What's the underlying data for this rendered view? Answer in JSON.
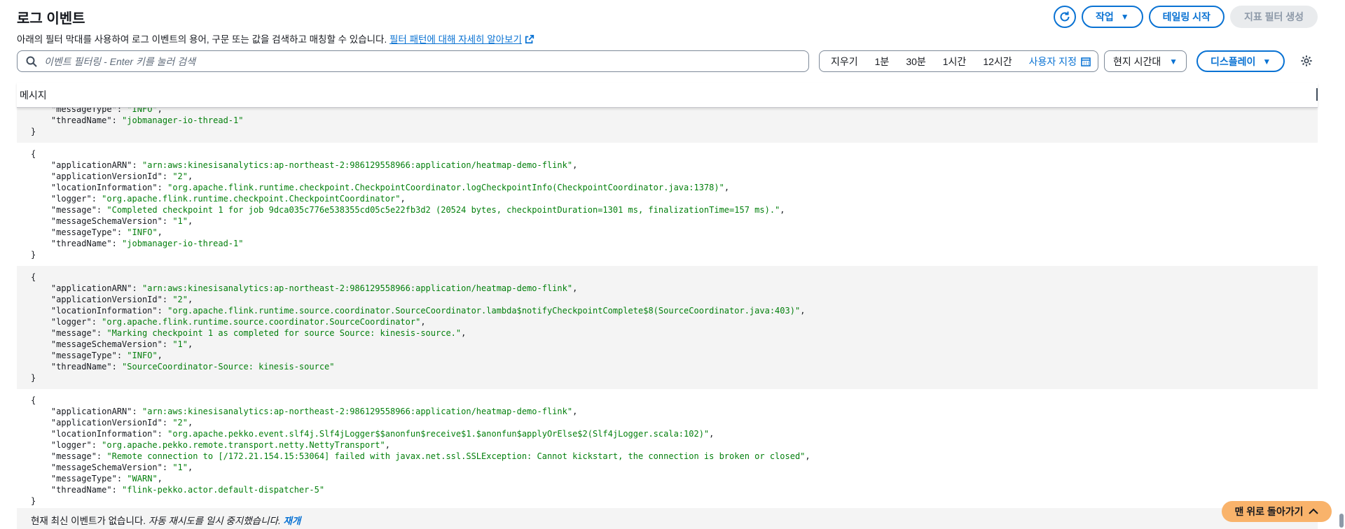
{
  "header": {
    "title": "로그 이벤트",
    "description": "아래의 필터 막대를 사용하여 로그 이벤트의 용어, 구문 또는 값을 검색하고 매칭할 수 있습니다.",
    "learn_more": "필터 패턴에 대해 자세히 알아보기"
  },
  "actions": {
    "refresh_icon": "refresh-icon",
    "actions_label": "작업",
    "tail_label": "테일링 시작",
    "metric_filter_label": "지표 필터 생성"
  },
  "search": {
    "placeholder": "이벤트 필터링 - Enter 키를 눌러 검색"
  },
  "time_range": {
    "options": [
      "지우기",
      "1분",
      "30분",
      "1시간",
      "12시간",
      "사용자 지정"
    ]
  },
  "timezone": {
    "value": "현지 시간대"
  },
  "display": {
    "label": "디스플레이"
  },
  "table": {
    "column": "메시지"
  },
  "entries": [
    {
      "shaded": true,
      "partial": true,
      "lines": [
        {
          "k": "messageType",
          "v": "INFO",
          "comma": true
        },
        {
          "k": "threadName",
          "v": "jobmanager-io-thread-1",
          "comma": false
        }
      ]
    },
    {
      "shaded": false,
      "partial": false,
      "lines": [
        {
          "k": "applicationARN",
          "v": "arn:aws:kinesisanalytics:ap-northeast-2:986129558966:application/heatmap-demo-flink",
          "comma": true
        },
        {
          "k": "applicationVersionId",
          "v": "2",
          "comma": true
        },
        {
          "k": "locationInformation",
          "v": "org.apache.flink.runtime.checkpoint.CheckpointCoordinator.logCheckpointInfo(CheckpointCoordinator.java:1378)",
          "comma": true
        },
        {
          "k": "logger",
          "v": "org.apache.flink.runtime.checkpoint.CheckpointCoordinator",
          "comma": true
        },
        {
          "k": "message",
          "v": "Completed checkpoint 1 for job 9dca035c776e538355cd05c5e22fb3d2 (20524 bytes, checkpointDuration=1301 ms, finalizationTime=157 ms).",
          "comma": true
        },
        {
          "k": "messageSchemaVersion",
          "v": "1",
          "comma": true
        },
        {
          "k": "messageType",
          "v": "INFO",
          "comma": true
        },
        {
          "k": "threadName",
          "v": "jobmanager-io-thread-1",
          "comma": false
        }
      ]
    },
    {
      "shaded": true,
      "partial": false,
      "lines": [
        {
          "k": "applicationARN",
          "v": "arn:aws:kinesisanalytics:ap-northeast-2:986129558966:application/heatmap-demo-flink",
          "comma": true
        },
        {
          "k": "applicationVersionId",
          "v": "2",
          "comma": true
        },
        {
          "k": "locationInformation",
          "v": "org.apache.flink.runtime.source.coordinator.SourceCoordinator.lambda$notifyCheckpointComplete$8(SourceCoordinator.java:403)",
          "comma": true
        },
        {
          "k": "logger",
          "v": "org.apache.flink.runtime.source.coordinator.SourceCoordinator",
          "comma": true
        },
        {
          "k": "message",
          "v": "Marking checkpoint 1 as completed for source Source: kinesis-source.",
          "comma": true
        },
        {
          "k": "messageSchemaVersion",
          "v": "1",
          "comma": true
        },
        {
          "k": "messageType",
          "v": "INFO",
          "comma": true
        },
        {
          "k": "threadName",
          "v": "SourceCoordinator-Source: kinesis-source",
          "comma": false
        }
      ]
    },
    {
      "shaded": false,
      "partial": false,
      "lines": [
        {
          "k": "applicationARN",
          "v": "arn:aws:kinesisanalytics:ap-northeast-2:986129558966:application/heatmap-demo-flink",
          "comma": true
        },
        {
          "k": "applicationVersionId",
          "v": "2",
          "comma": true
        },
        {
          "k": "locationInformation",
          "v": "org.apache.pekko.event.slf4j.Slf4jLogger$$anonfun$receive$1.$anonfun$applyOrElse$2(Slf4jLogger.scala:102)",
          "comma": true
        },
        {
          "k": "logger",
          "v": "org.apache.pekko.remote.transport.netty.NettyTransport",
          "comma": true
        },
        {
          "k": "message",
          "v": "Remote connection to [/172.21.154.15:53064] failed with javax.net.ssl.SSLException: Cannot kickstart, the connection is broken or closed",
          "comma": true
        },
        {
          "k": "messageSchemaVersion",
          "v": "1",
          "comma": true
        },
        {
          "k": "messageType",
          "v": "WARN",
          "comma": true
        },
        {
          "k": "threadName",
          "v": "flink-pekko.actor.default-dispatcher-5",
          "comma": false
        }
      ]
    }
  ],
  "status": {
    "text": "현재 최신 이벤트가 없습니다.",
    "paused": "자동 재시도를 일시 중지했습니다.",
    "resume": "재개"
  },
  "back_to_top": "맨 위로 돌아가기",
  "colors": {
    "accent": "#0972d3",
    "string": "#037f0c",
    "orange": "#f9b36b"
  }
}
